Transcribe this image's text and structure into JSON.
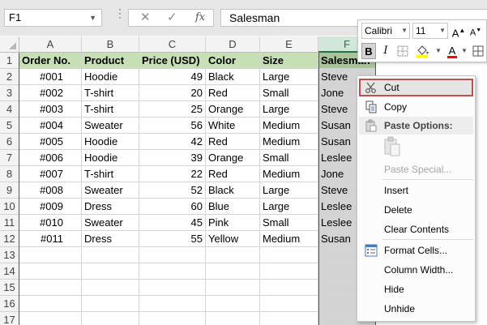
{
  "formula_bar": {
    "name_box": "F1",
    "formula": "Salesman",
    "cancel_icon": "✕",
    "enter_icon": "✓",
    "fx_label": "fx"
  },
  "columns": [
    "A",
    "B",
    "C",
    "D",
    "E",
    "F"
  ],
  "rows": [
    "1",
    "2",
    "3",
    "4",
    "5",
    "6",
    "7",
    "8",
    "9",
    "10",
    "11",
    "12",
    "13",
    "14",
    "15",
    "16",
    "17"
  ],
  "table": {
    "headers": [
      "Order No.",
      "Product",
      "Price (USD)",
      "Color",
      "Size",
      "Salesman"
    ],
    "rows": [
      [
        "#001",
        "Hoodie",
        "49",
        "Black",
        "Large",
        "Steve"
      ],
      [
        "#002",
        "T-shirt",
        "20",
        "Red",
        "Small",
        "Jone"
      ],
      [
        "#003",
        "T-shirt",
        "25",
        "Orange",
        "Large",
        "Steve"
      ],
      [
        "#004",
        "Sweater",
        "56",
        "White",
        "Medium",
        "Susan"
      ],
      [
        "#005",
        "Hoodie",
        "42",
        "Red",
        "Medium",
        "Susan"
      ],
      [
        "#006",
        "Hoodie",
        "39",
        "Orange",
        "Small",
        "Leslee"
      ],
      [
        "#007",
        "T-shirt",
        "22",
        "Red",
        "Medium",
        "Jone"
      ],
      [
        "#008",
        "Sweater",
        "52",
        "Black",
        "Large",
        "Steve"
      ],
      [
        "#009",
        "Dress",
        "60",
        "Blue",
        "Large",
        "Leslee"
      ],
      [
        "#010",
        "Sweater",
        "45",
        "Pink",
        "Small",
        "Leslee"
      ],
      [
        "#011",
        "Dress",
        "55",
        "Yellow",
        "Medium",
        "Susan"
      ]
    ]
  },
  "mini_toolbar": {
    "font_name": "Calibri",
    "font_size": "11",
    "grow_label": "A",
    "shrink_label": "A",
    "bold_label": "B",
    "italic_label": "I",
    "font_color_label": "A",
    "font_color": "#ff0000",
    "fill_color": "#ffff00"
  },
  "context_menu": {
    "cut": "Cut",
    "copy": "Copy",
    "paste_options": "Paste Options:",
    "paste_special": "Paste Special...",
    "insert": "Insert",
    "delete": "Delete",
    "clear_contents": "Clear Contents",
    "format_cells": "Format Cells...",
    "column_width": "Column Width...",
    "hide": "Hide",
    "unhide": "Unhide"
  },
  "colors": {
    "header_fill": "#c6e0b4",
    "selection_green": "#217346",
    "highlight_border": "#c0504d"
  }
}
